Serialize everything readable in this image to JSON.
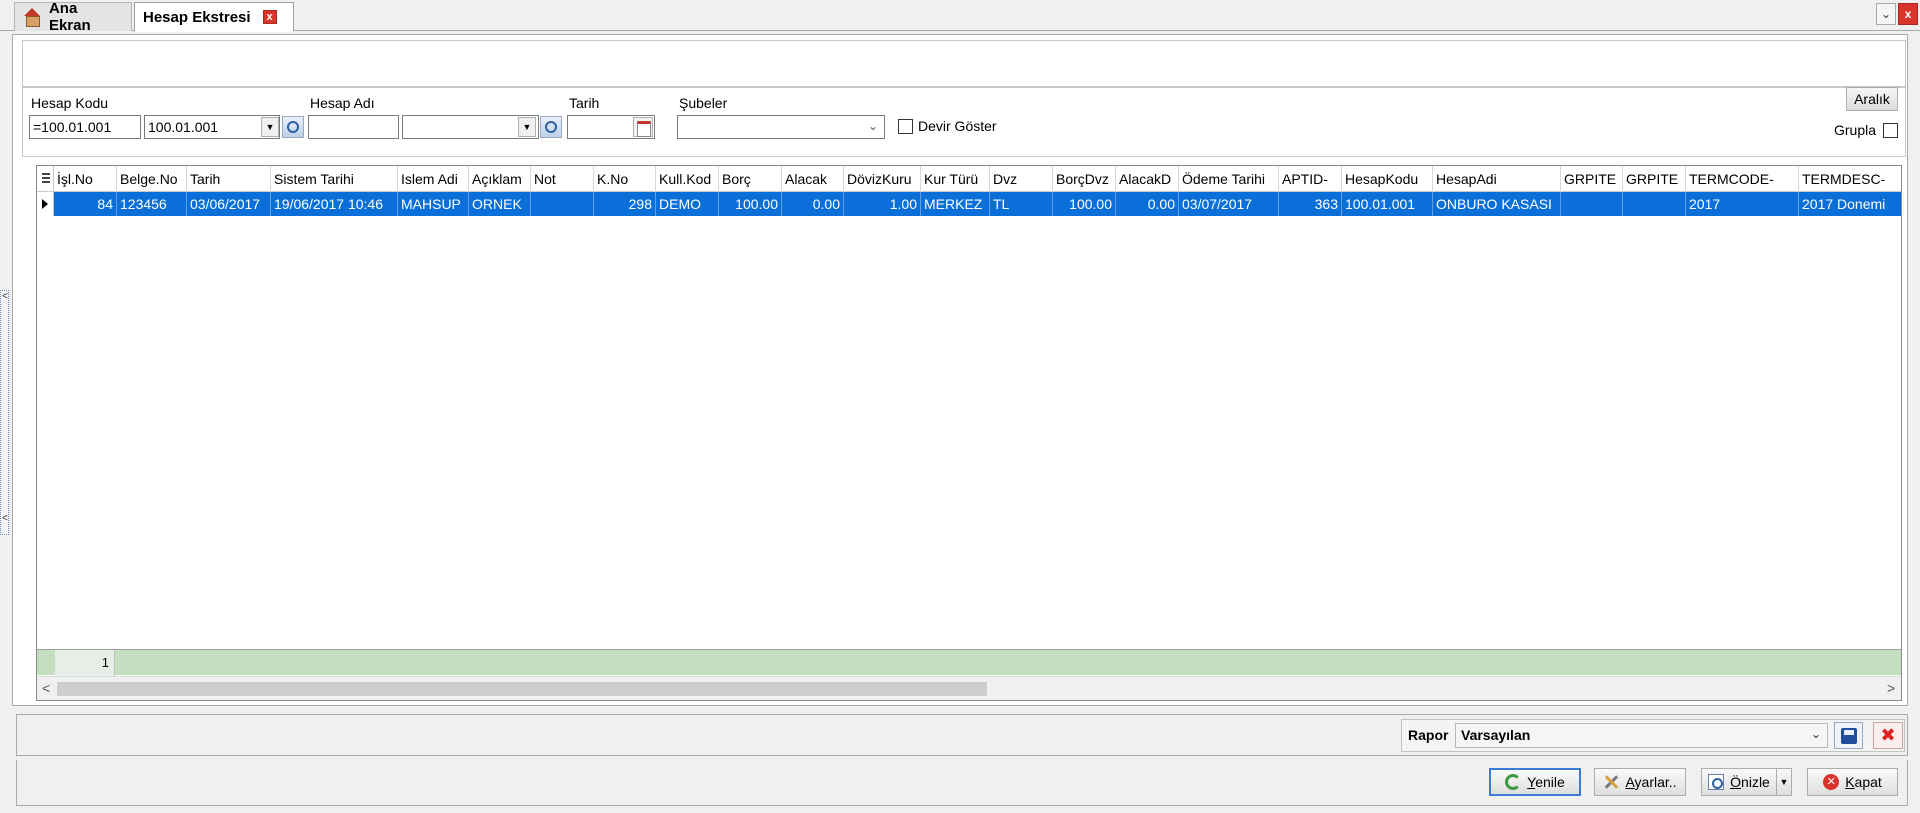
{
  "tabs": [
    {
      "label": "Ana Ekran"
    },
    {
      "label": "Hesap Ekstresi"
    }
  ],
  "tab_close_glyph": "x",
  "window": {
    "menu_glyph": "⌄",
    "close_glyph": "x"
  },
  "filters": {
    "hesap_kodu_label": "Hesap Kodu",
    "hesap_kodu_value": "=100.01.001",
    "hesap_kodu_combo_value": "100.01.001",
    "hesap_adi_label": "Hesap Adı",
    "hesap_adi_value": "",
    "hesap_adi_combo_value": "",
    "tarih_label": "Tarih",
    "tarih_value": "",
    "subeler_label": "Şubeler",
    "subeler_value": "",
    "devir_goster_label": "Devir Göster",
    "aralik_label": "Aralık",
    "grupla_label": "Grupla"
  },
  "grid": {
    "columns": [
      "İşl.No",
      "Belge.No",
      "Tarih",
      "Sistem Tarihi",
      "Islem Adi",
      "Açıklam",
      "Not",
      "K.No",
      "Kull.Kod",
      "Borç",
      "Alacak",
      "DövizKuru",
      "Kur Türü",
      "Dvz",
      "BorçDvz",
      "AlacakD",
      "Ödeme Tarihi",
      "APTID-",
      "HesapKodu",
      "HesapAdi",
      "GRPITE",
      "GRPITE",
      "TERMCODE-",
      "TERMDESC-"
    ],
    "rows": [
      [
        "84",
        "123456",
        "03/06/2017",
        "19/06/2017 10:46",
        "MAHSUP",
        "ORNEK",
        "",
        "298",
        "DEMO",
        "100.00",
        "0.00",
        "1.00",
        "MERKEZ",
        "TL",
        "100.00",
        "0.00",
        "03/07/2017",
        "363",
        "100.01.001",
        "ONBURO KASASI",
        "",
        "",
        "2017",
        "2017 Donemi"
      ]
    ],
    "footer_count": "1"
  },
  "report": {
    "label": "Rapor",
    "selected": "Varsayılan"
  },
  "actions": {
    "yenile": "Yenile",
    "ayarlar": "Ayarlar..",
    "onizle": "Önizle",
    "kapat": "Kapat"
  },
  "colors": {
    "selection": "#0a6fd8",
    "footer": "#c3dfc0",
    "accent_close": "#d9342b"
  }
}
